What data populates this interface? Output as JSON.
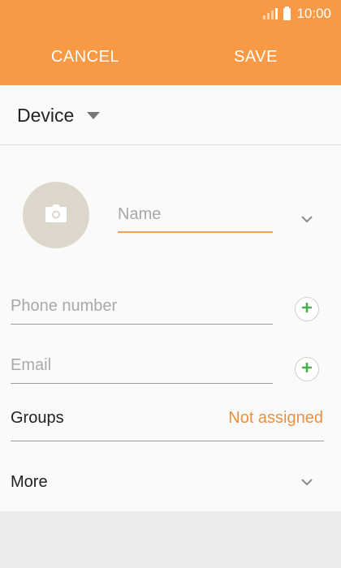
{
  "status_bar": {
    "time": "10:00",
    "icons": [
      "signal-icon",
      "battery-icon"
    ]
  },
  "toolbar": {
    "cancel_label": "CANCEL",
    "save_label": "SAVE"
  },
  "account": {
    "label": "Device"
  },
  "form": {
    "name_placeholder": "Name",
    "phone_placeholder": "Phone number",
    "email_placeholder": "Email"
  },
  "groups": {
    "label": "Groups",
    "value": "Not assigned"
  },
  "more": {
    "label": "More"
  },
  "colors": {
    "accent": "#f89a45",
    "value_orange": "#e8903f",
    "add_green": "#4caf50",
    "avatar_bg": "#ddd6ca"
  }
}
